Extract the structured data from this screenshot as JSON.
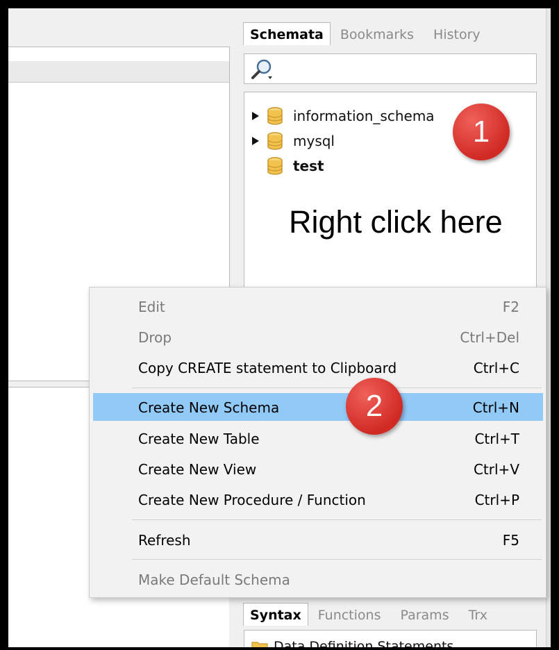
{
  "schema_tabs": [
    "Schemata",
    "Bookmarks",
    "History"
  ],
  "tree": [
    {
      "label": "information_schema",
      "expandable": true,
      "bold": false
    },
    {
      "label": "mysql",
      "expandable": true,
      "bold": false
    },
    {
      "label": "test",
      "expandable": false,
      "bold": true
    }
  ],
  "annotations": {
    "first": "1",
    "second": "2"
  },
  "hint": "Right click here",
  "context_menu": [
    {
      "label": "Edit",
      "shortcut": "F2",
      "disabled": true
    },
    {
      "label": "Drop",
      "shortcut": "Ctrl+Del",
      "disabled": true
    },
    {
      "label": "Copy CREATE statement to Clipboard",
      "shortcut": "Ctrl+C",
      "disabled": false
    },
    {
      "label": "Create New Schema",
      "shortcut": "Ctrl+N",
      "disabled": false,
      "highlighted": true
    },
    {
      "label": "Create New Table",
      "shortcut": "Ctrl+T",
      "disabled": false
    },
    {
      "label": "Create New View",
      "shortcut": "Ctrl+V",
      "disabled": false
    },
    {
      "label": "Create New Procedure / Function",
      "shortcut": "Ctrl+P",
      "disabled": false
    },
    {
      "label": "Refresh",
      "shortcut": "F5",
      "disabled": false
    },
    {
      "label": "Make Default Schema",
      "shortcut": "",
      "disabled": true
    }
  ],
  "syntax_tabs": [
    "Syntax",
    "Functions",
    "Params",
    "Trx"
  ],
  "bottom_tree": {
    "label": "Data Definition Statements"
  },
  "colors": {
    "highlight": "#91c9f7",
    "annotation": "#d12a24",
    "db_icon": "#f2c24f"
  }
}
